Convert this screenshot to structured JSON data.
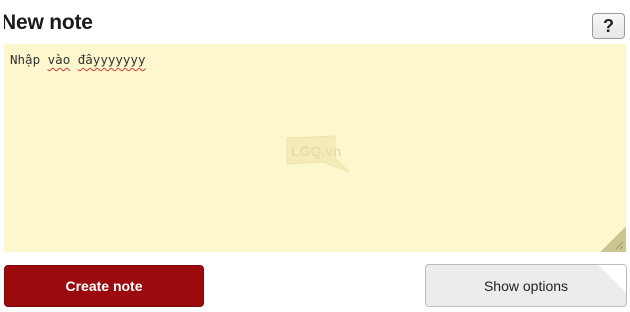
{
  "header": {
    "title_first_char": "N",
    "title_rest": "ew note",
    "help_label": "?"
  },
  "note": {
    "text_plain": "Nhập ",
    "text_misspelled_1": "vào",
    "text_space": " ",
    "text_misspelled_2": "đâyyyyyyy",
    "watermark_text": "LGQ.vn"
  },
  "actions": {
    "create_label": "Create note",
    "options_label": "Show options"
  },
  "colors": {
    "note_bg": "#fdf7cd",
    "create_bg": "#9b0b0e",
    "options_bg": "#ececec"
  }
}
